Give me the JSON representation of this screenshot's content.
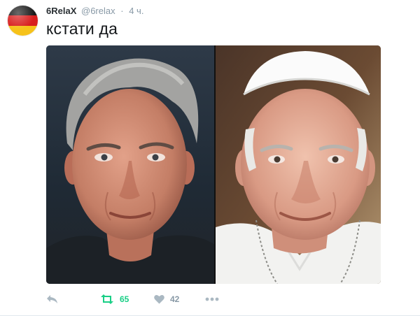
{
  "tweet": {
    "display_name": "6RelaX",
    "handle": "@6relax",
    "separator": "·",
    "time": "4 ч.",
    "text": "кстати да",
    "avatar": {
      "kind": "german-flag",
      "colors": [
        "#1a1a1a",
        "#d81e1e",
        "#f6c21a"
      ]
    }
  },
  "media": {
    "kind": "photo-collage",
    "panels": [
      "left-portrait",
      "right-portrait"
    ]
  },
  "actions": {
    "reply": {
      "icon": "reply-icon"
    },
    "retweet": {
      "icon": "retweet-icon",
      "count": "65",
      "color": "#19cf86"
    },
    "like": {
      "icon": "heart-icon",
      "count": "42"
    },
    "more": {
      "icon": "more-icon"
    }
  }
}
